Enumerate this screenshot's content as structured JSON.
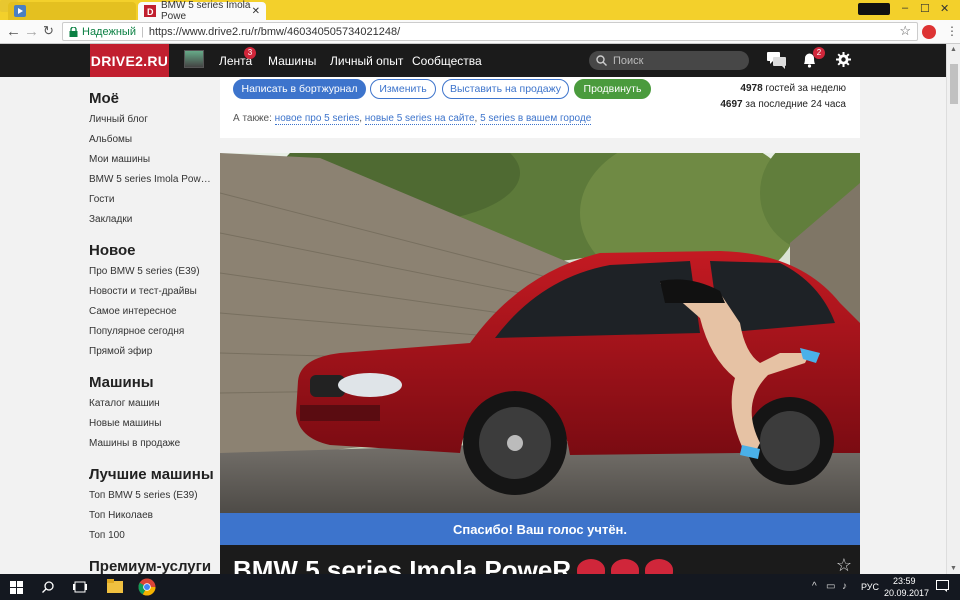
{
  "browser": {
    "tabs": [
      {
        "label": ""
      },
      {
        "label": "BMW 5 series Imola Powe"
      }
    ],
    "secure_label": "Надежный",
    "url": "https://www.drive2.ru/r/bmw/460340505734021248/"
  },
  "site": {
    "logo": "DRIVE2.RU",
    "nav": [
      {
        "label": "Лента",
        "badge": "3"
      },
      {
        "label": "Машины"
      },
      {
        "label": "Личный опыт"
      },
      {
        "label": "Сообщества"
      }
    ],
    "search_placeholder": "Поиск",
    "notifications_badge": "2"
  },
  "sidebar": {
    "sections": [
      {
        "title": "Моё",
        "items": [
          "Личный блог",
          "Альбомы",
          "Мои машины",
          "BMW 5 series Imola Powe…",
          "Гости",
          "Закладки"
        ]
      },
      {
        "title": "Новое",
        "items": [
          "Про BMW 5 series (E39)",
          "Новости и тест-драйвы",
          "Самое интересное",
          "Популярное сегодня",
          "Прямой эфир"
        ]
      },
      {
        "title": "Машины",
        "items": [
          "Каталог машин",
          "Новые машины",
          "Машины в продаже"
        ]
      },
      {
        "title": "Лучшие машины",
        "items": [
          "Топ BMW 5 series (E39)",
          "Топ Николаев",
          "Топ 100"
        ]
      },
      {
        "title": "Премиум-услуги",
        "items": []
      }
    ]
  },
  "actions": {
    "write": "Написать в бортжурнал",
    "edit": "Изменить",
    "sell": "Выставить на продажу",
    "promote": "Продвинуть"
  },
  "stats": {
    "week_count": "4978",
    "week_label": "гостей за неделю",
    "day_count": "4697",
    "day_label": "за последние 24 часа"
  },
  "also": {
    "prefix": "А также:",
    "links": [
      "новое про 5 series",
      "новые 5 series на сайте",
      "5 series в вашем городе"
    ]
  },
  "vote_message": "Спасибо! Ваш голос учтён.",
  "car_title": "BMW 5 series Imola PoweR",
  "colors": {
    "brand_red": "#c11f2f",
    "accent_blue": "#3d74cc",
    "green": "#4a9b3d"
  },
  "taskbar": {
    "lang": "РУС",
    "time": "23:59",
    "date": "20.09.2017"
  }
}
